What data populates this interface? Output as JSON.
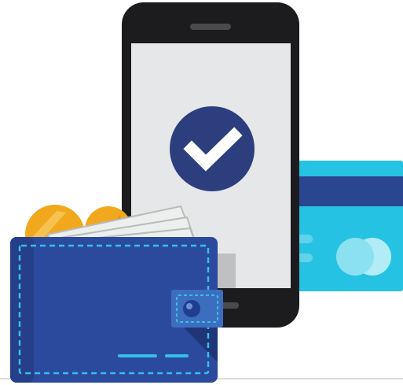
{
  "illustration": {
    "colors": {
      "background": "#ffffff",
      "baseline": "#dcdcdc",
      "phone_body": "#1c1c1e",
      "phone_screen": "#e6e7e9",
      "phone_speaker": "#4a4a4c",
      "phone_home": "#4a4a4c",
      "check_circle": "#2c3e7d",
      "check_mark": "#ffffff",
      "card_body": "#26c2e3",
      "card_stripe": "#2b4690",
      "card_chip": "#5fd3ea",
      "card_logo_left": "#8ce1f0",
      "card_logo_right": "#b2ecf6",
      "coin": "#f2a81d",
      "coin_shade": "#e08e16",
      "coin_highlight": "#f7c350",
      "banknote": "#ecefed",
      "banknote_edge": "#b7bcb8",
      "wallet_body": "#2b4a9e",
      "wallet_side": "#263f8a",
      "wallet_shadow": "#1f3577",
      "wallet_stitch": "#35c0e4",
      "clasp": "#3d6dbe",
      "clasp_button": "#1f3e8e",
      "clasp_button_highlight": "#6f8fd6",
      "wallet_slot": "#35c0e4"
    },
    "icons": {
      "status": "checkmark-icon",
      "card_logo": "card-logo-icon"
    }
  }
}
